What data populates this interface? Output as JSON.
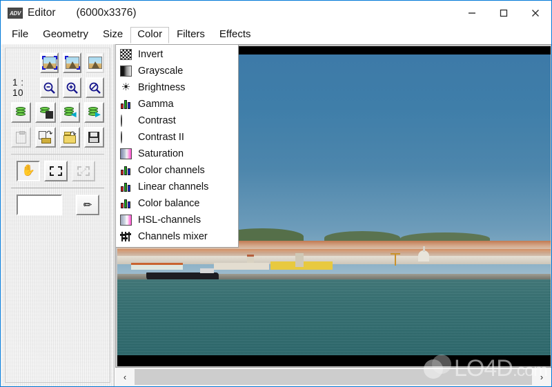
{
  "window": {
    "app_icon_text": "ADV",
    "title": "Editor",
    "dimensions": "(6000x3376)",
    "minimize_label": "minimize-icon",
    "maximize_label": "maximize-icon",
    "close_label": "close-icon"
  },
  "menubar": {
    "items": [
      {
        "label": "File",
        "active": false
      },
      {
        "label": "Geometry",
        "active": false
      },
      {
        "label": "Size",
        "active": false
      },
      {
        "label": "Color",
        "active": true
      },
      {
        "label": "Filters",
        "active": false
      },
      {
        "label": "Effects",
        "active": false
      }
    ]
  },
  "color_menu": {
    "open": true,
    "items": [
      {
        "label": "Invert",
        "icon": "checkerboard-icon"
      },
      {
        "label": "Grayscale",
        "icon": "grayscale-gradient-icon"
      },
      {
        "label": "Brightness",
        "icon": "sun-icon"
      },
      {
        "label": "Gamma",
        "icon": "rgb-bars-icon"
      },
      {
        "label": "Contrast",
        "icon": "contrast-circle-icon"
      },
      {
        "label": "Contrast II",
        "icon": "contrast-circle-icon"
      },
      {
        "label": "Saturation",
        "icon": "saturation-gradient-icon"
      },
      {
        "label": "Color channels",
        "icon": "rgb-bars-icon"
      },
      {
        "label": "Linear channels",
        "icon": "rgb-bars-icon"
      },
      {
        "label": "Color balance",
        "icon": "rgb-bars-icon"
      },
      {
        "label": "HSL-channels",
        "icon": "hsl-gradient-icon"
      },
      {
        "label": "Channels mixer",
        "icon": "sliders-icon"
      }
    ]
  },
  "toolbar": {
    "zoom_ratio": "1 : 10",
    "row_thumbs": [
      {
        "name": "fit-to-window-button",
        "state": "normal"
      },
      {
        "name": "actual-size-button",
        "state": "normal"
      },
      {
        "name": "full-image-button",
        "state": "flat"
      }
    ],
    "row_zoom": [
      {
        "name": "zoom-out-button",
        "glyph": "−"
      },
      {
        "name": "zoom-in-button",
        "glyph": "+"
      },
      {
        "name": "zoom-reset-button",
        "glyph": "/"
      }
    ],
    "row_db": [
      {
        "name": "buffer-button"
      },
      {
        "name": "buffer-save-button"
      },
      {
        "name": "buffer-load-button"
      },
      {
        "name": "buffer-store-button"
      }
    ],
    "row_file": [
      {
        "name": "paste-button",
        "state": "disabled"
      },
      {
        "name": "reload-button",
        "state": "normal"
      },
      {
        "name": "open-button",
        "state": "normal"
      },
      {
        "name": "save-button",
        "state": "normal"
      }
    ],
    "row_tools": [
      {
        "name": "pan-hand-tool",
        "state": "pressed"
      },
      {
        "name": "rectangle-select-tool",
        "state": "normal"
      },
      {
        "name": "crop-tool",
        "state": "disabled"
      }
    ],
    "swatch": {
      "name": "foreground-color-swatch",
      "color": "#ffffff"
    },
    "pencil": {
      "name": "pencil-tool"
    }
  },
  "scrollbar": {
    "left_arrow": "‹",
    "right_arrow": "›",
    "thumb_position": "full"
  },
  "watermark": {
    "text": "LO4D",
    "suffix": ".com"
  },
  "colors": {
    "window_border": "#0078d7",
    "panel_bg": "#e9e9e9",
    "canvas_letterbox": "#000000",
    "sky": "#3d7aa8",
    "water": "#356f72"
  }
}
